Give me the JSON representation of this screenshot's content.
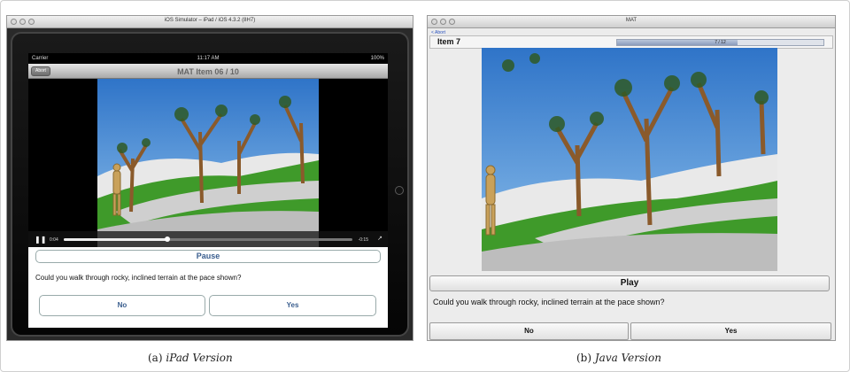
{
  "ipad": {
    "window_title": "iOS Simulator – iPad / iOS 4.3.2 (8H7)",
    "status": {
      "carrier": "Carrier",
      "time": "11:17 AM",
      "battery": "100%"
    },
    "nav": {
      "abort_label": "Abort",
      "title": "MAT Item 06 / 10"
    },
    "video": {
      "elapsed": "0:04",
      "remaining": "-0:15",
      "progress": 0.36
    },
    "pause_label": "Pause",
    "question": "Could you walk through rocky, inclined terrain at the pace shown?",
    "no_label": "No",
    "yes_label": "Yes"
  },
  "java": {
    "window_title": "MAT",
    "abort_label": "< Abort",
    "item_label": "Item 7",
    "progress_text": "7 / 12",
    "progress_value": 0.583,
    "play_label": "Play",
    "question": "Could you walk through rocky, inclined terrain at the pace shown?",
    "no_label": "No",
    "yes_label": "Yes"
  },
  "captions": {
    "a_prefix": "(a)",
    "a_text": "iPad Version",
    "b_prefix": "(b)",
    "b_text": "Java Version"
  },
  "colors": {
    "ios_button_text": "#3a5e8e",
    "sky": "#3f86d6",
    "grass": "#3f9a2a",
    "rock": "#d9d9d9"
  }
}
